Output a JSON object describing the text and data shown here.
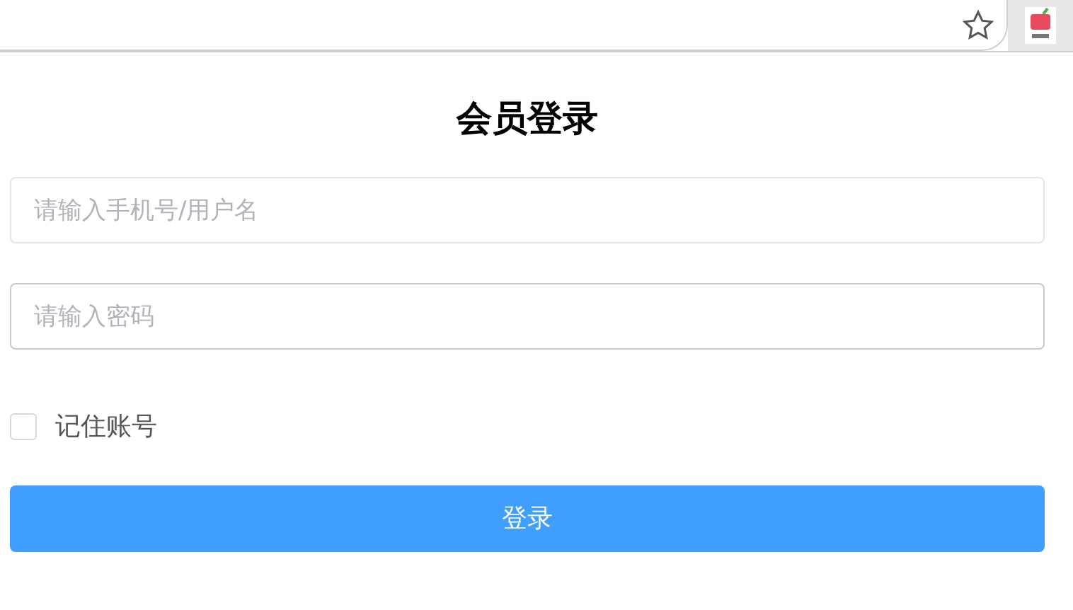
{
  "title": "会员登录",
  "fields": [
    {
      "placeholder": "请输入手机号/用户名"
    },
    {
      "placeholder": "请输入密码"
    }
  ],
  "remember": {
    "label": "记住账号",
    "checked": false
  },
  "login_button": "登录"
}
